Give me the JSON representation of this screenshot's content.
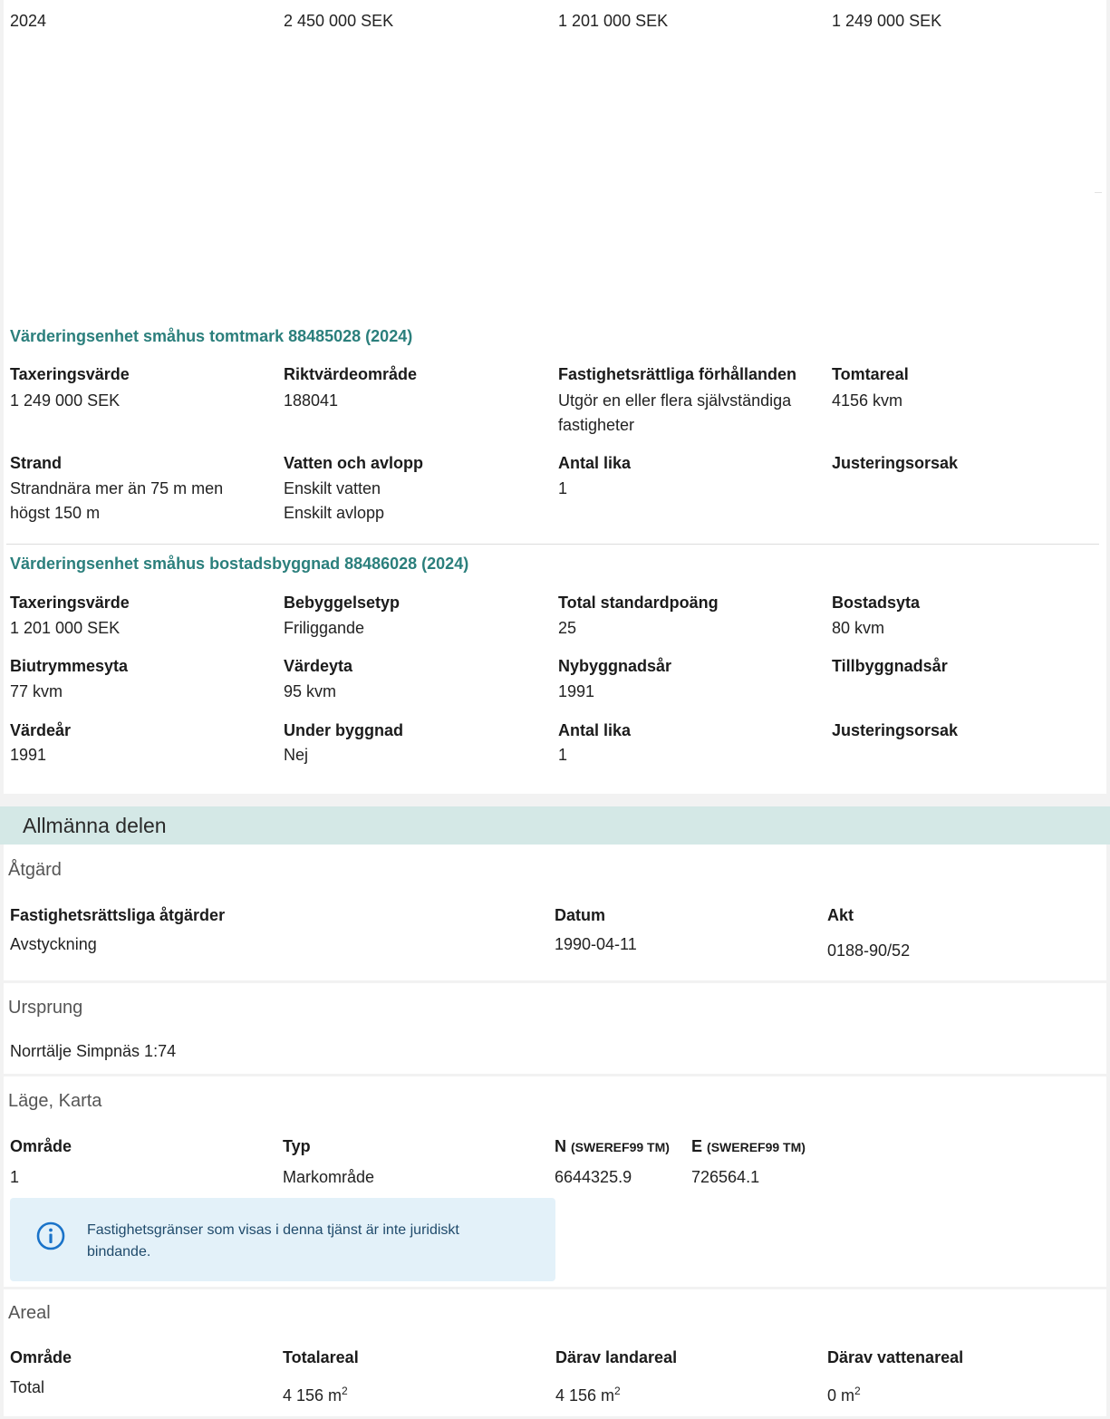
{
  "year_row": {
    "year": "2024",
    "total": "2 450 000 SEK",
    "building": "1 201 000 SEK",
    "land": "1 249 000 SEK"
  },
  "tomtmark": {
    "title": "Värderingsenhet småhus tomtmark 88485028 (2024)",
    "fields": [
      {
        "label": "Taxeringsvärde",
        "lines": [
          "1 249 000 SEK"
        ]
      },
      {
        "label": "Riktvärdeområde",
        "lines": [
          "188041"
        ]
      },
      {
        "label": "Fastighetsrättliga förhållanden",
        "lines": [
          "Utgör en eller flera självständiga",
          "fastigheter"
        ]
      },
      {
        "label": "Tomtareal",
        "lines": [
          "4156 kvm"
        ]
      },
      {
        "label": "Strand",
        "lines": [
          "Strandnära mer än 75 m men",
          "högst 150 m"
        ]
      },
      {
        "label": "Vatten och avlopp",
        "lines": [
          "Enskilt vatten",
          "Enskilt avlopp"
        ]
      },
      {
        "label": "Antal lika",
        "lines": [
          "1"
        ]
      },
      {
        "label": "Justeringsorsak",
        "lines": []
      }
    ]
  },
  "bostadsbyggnad": {
    "title": "Värderingsenhet småhus bostadsbyggnad 88486028 (2024)",
    "fields": [
      {
        "label": "Taxeringsvärde",
        "lines": [
          "1 201 000 SEK"
        ]
      },
      {
        "label": "Bebyggelsetyp",
        "lines": [
          "Friliggande"
        ]
      },
      {
        "label": "Total standardpoäng",
        "lines": [
          "25"
        ]
      },
      {
        "label": "Bostadsyta",
        "lines": [
          "80 kvm"
        ]
      },
      {
        "label": "Biutrymmesyta",
        "lines": [
          "77 kvm"
        ]
      },
      {
        "label": "Värdeyta",
        "lines": [
          "95 kvm"
        ]
      },
      {
        "label": "Nybyggnadsår",
        "lines": [
          "1991"
        ]
      },
      {
        "label": "Tillbyggnadsår",
        "lines": []
      },
      {
        "label": "Värdeår",
        "lines": [
          "1991"
        ]
      },
      {
        "label": "Under byggnad",
        "lines": [
          "Nej"
        ]
      },
      {
        "label": "Antal lika",
        "lines": [
          "1"
        ]
      },
      {
        "label": "Justeringsorsak",
        "lines": []
      }
    ]
  },
  "allmanna": {
    "title": "Allmänna delen",
    "atgard": {
      "heading": "Åtgärd",
      "col_atgard": "Fastighetsrättsliga åtgärder",
      "col_datum": "Datum",
      "col_akt": "Akt",
      "atgard": "Avstyckning",
      "datum": "1990-04-11",
      "akt": "0188-90/52"
    },
    "ursprung": {
      "heading": "Ursprung",
      "value": "Norrtälje Simpnäs 1:74"
    },
    "lage": {
      "heading": "Läge, Karta",
      "col_omrade": "Område",
      "col_typ": "Typ",
      "col_n": "N",
      "col_n_sub": "(SWEREF99 TM)",
      "col_e": "E",
      "col_e_sub": "(SWEREF99 TM)",
      "omrade": "1",
      "typ": "Markområde",
      "n": "6644325.9",
      "e": "726564.1",
      "info": "Fastighetsgränser som visas i denna tjänst är inte juridiskt bindande."
    },
    "areal": {
      "heading": "Areal",
      "col_omrade": "Område",
      "col_total": "Totalareal",
      "col_land": "Därav landareal",
      "col_vatten": "Därav vattenareal",
      "omrade": "Total",
      "total": "4 156 m",
      "land": "4 156 m",
      "vatten": "0 m",
      "unit_exp": "2"
    }
  }
}
